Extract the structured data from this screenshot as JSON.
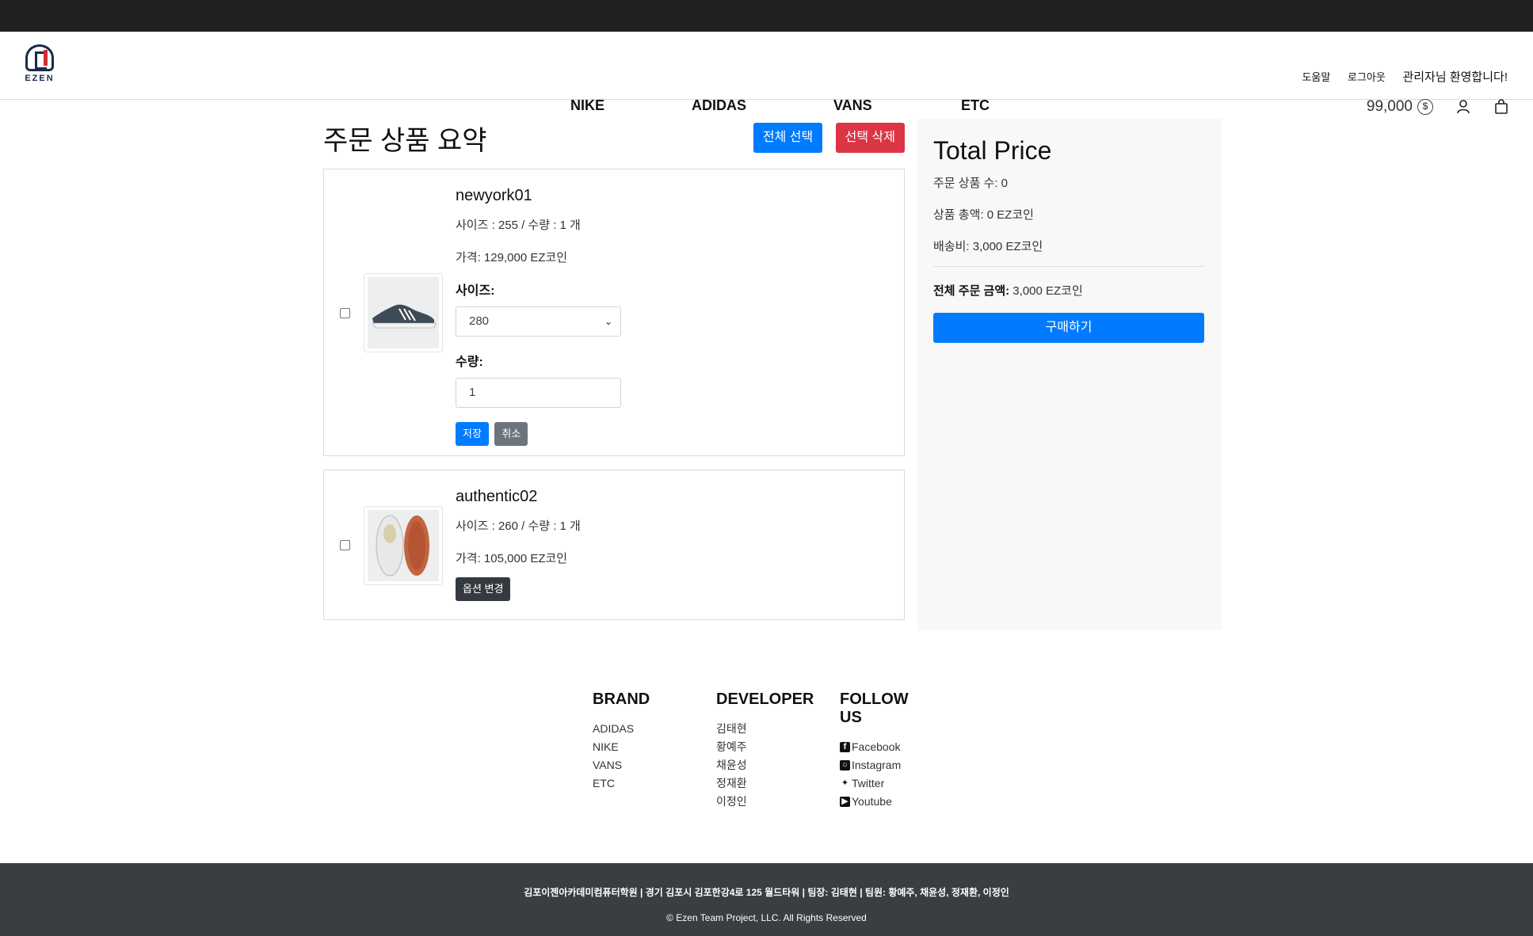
{
  "header": {
    "logo_text": "EZEN",
    "nav": [
      "NIKE",
      "ADIDAS",
      "VANS",
      "ETC"
    ],
    "utils": {
      "help": "도움말",
      "logout": "로그아웃",
      "welcome": "관리자님 환영합니다!"
    },
    "wallet_amount": "99,000",
    "coin_symbol": "$"
  },
  "main": {
    "title": "주문 상품 요약",
    "select_all": "전체 선택",
    "delete_selected": "선택 삭제",
    "items": [
      {
        "name": "newyork01",
        "size_qty": "사이즈 : 255 / 수량 : 1 개",
        "price": "가격: 129,000 EZ코인",
        "size_label": "사이즈:",
        "size_value": "280",
        "qty_label": "수량:",
        "qty_value": "1",
        "save": "저장",
        "cancel": "취소"
      },
      {
        "name": "authentic02",
        "size_qty": "사이즈 : 260 / 수량 : 1 개",
        "price": "가격: 105,000 EZ코인",
        "change_option": "옵션 변경"
      }
    ]
  },
  "summary": {
    "title": "Total Price",
    "count": "주문 상품 수: 0",
    "subtotal": "상품 총액: 0 EZ코인",
    "shipping": "배송비: 3,000 EZ코인",
    "total_label": "전체 주문 금액:",
    "total_value": " 3,000 EZ코인",
    "buy": "구매하기"
  },
  "footer": {
    "brand_title": "BRAND",
    "brands": [
      "ADIDAS",
      "NIKE",
      "VANS",
      "ETC"
    ],
    "developer_title": "DEVELOPER",
    "developers": [
      "김태현",
      "황예주",
      "채윤성",
      "정재환",
      "이정인"
    ],
    "follow_title": "FOLLOW US",
    "social": [
      "Facebook",
      "Instagram",
      "Twitter",
      "Youtube"
    ],
    "info_line": "김포이젠아카데미컴퓨터학원 | 경기 김포시 김포한강4로 125 월드타워 | 팀장: 김태현 | 팀원: 황예주, 채윤성, 정재환, 이정인",
    "copyright": "© Ezen Team Project, LLC. All Rights Reserved"
  },
  "colors": {
    "primary": "#007bff",
    "danger": "#dc3545",
    "secondary": "#6c757d",
    "dark": "#343a40",
    "topbar": "#212121",
    "footer": "#3a3d41"
  }
}
